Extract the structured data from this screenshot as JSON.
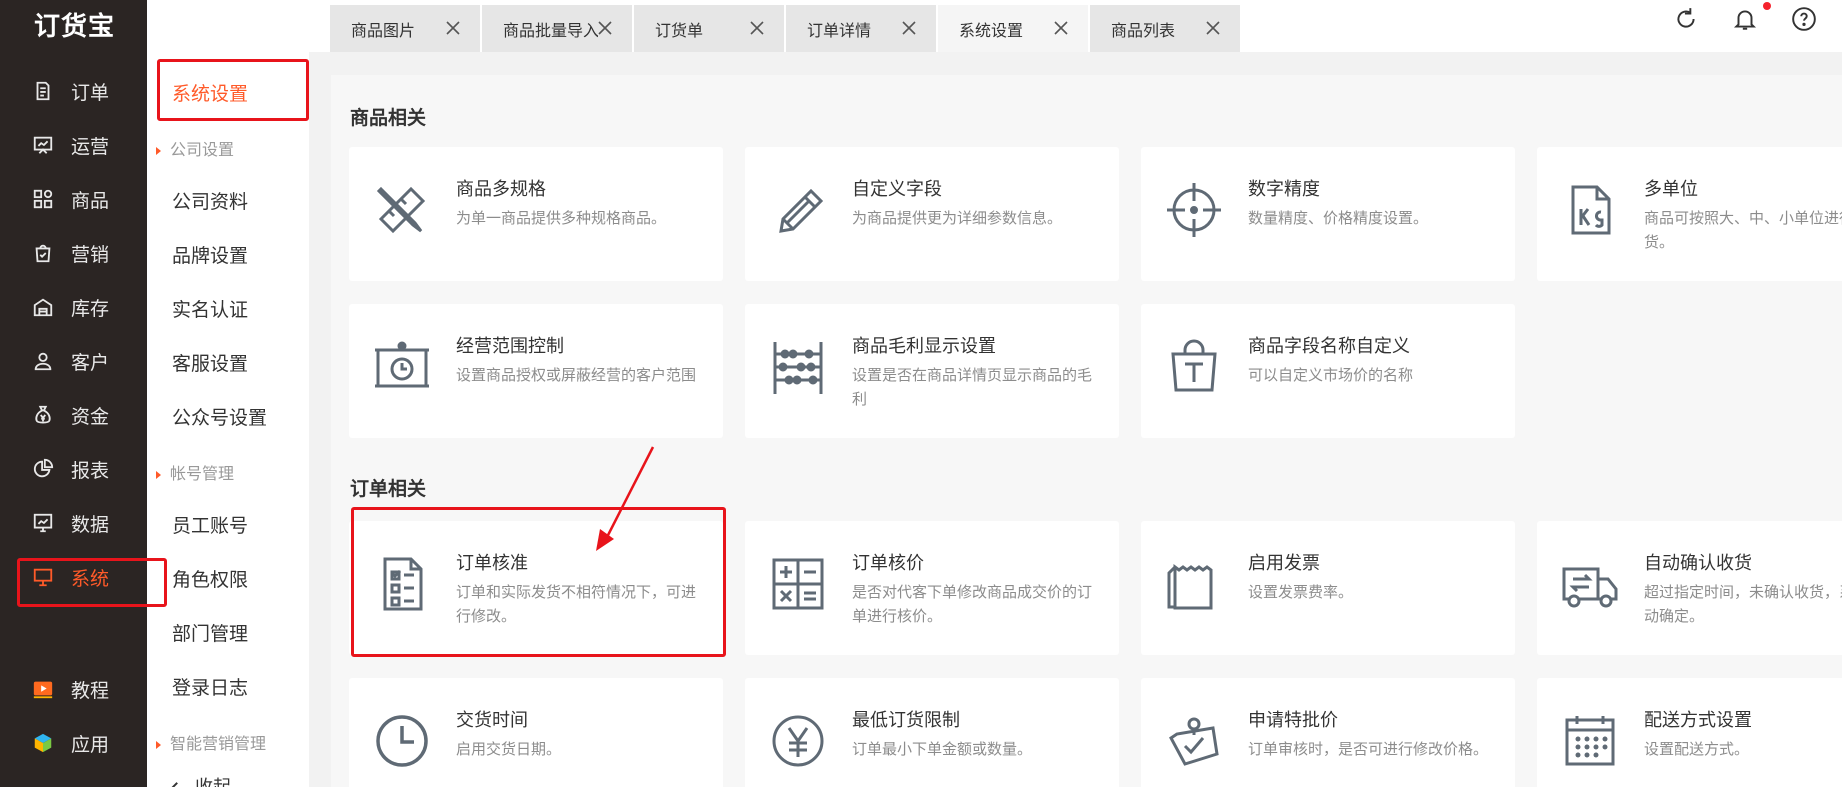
{
  "app": {
    "logo": "订货宝"
  },
  "nav": {
    "items": [
      {
        "label": "订单",
        "icon": "order-doc-icon"
      },
      {
        "label": "运营",
        "icon": "board-chart-icon"
      },
      {
        "label": "商品",
        "icon": "grid-apps-icon"
      },
      {
        "label": "营销",
        "icon": "marketing-bag-icon"
      },
      {
        "label": "库存",
        "icon": "warehouse-icon"
      },
      {
        "label": "客户",
        "icon": "user-icon"
      },
      {
        "label": "资金",
        "icon": "money-bag-icon"
      },
      {
        "label": "报表",
        "icon": "pie-chart-icon"
      },
      {
        "label": "数据",
        "icon": "data-chart-icon"
      },
      {
        "label": "系统",
        "icon": "monitor-icon"
      },
      {
        "label": "教程",
        "icon": "video-play-icon"
      },
      {
        "label": "应用",
        "icon": "cube-icon"
      }
    ]
  },
  "subnav": {
    "title": "系统设置",
    "group_company": "公司设置",
    "company_items": [
      "公司资料",
      "品牌设置",
      "实名认证",
      "客服设置",
      "公众号设置"
    ],
    "group_account": "帐号管理",
    "account_items": [
      "员工账号",
      "角色权限",
      "部门管理",
      "登录日志"
    ],
    "group_marketing": "智能营销管理",
    "collapse_label": "收起"
  },
  "tabs": [
    {
      "label": "商品图片"
    },
    {
      "label": "商品批量导入"
    },
    {
      "label": "订货单"
    },
    {
      "label": "订单详情"
    },
    {
      "label": "系统设置"
    },
    {
      "label": "商品列表"
    }
  ],
  "header_icons": [
    "refresh-icon",
    "bell-icon",
    "help-icon"
  ],
  "sections": {
    "goods": {
      "title": "商品相关",
      "cards": [
        {
          "title": "商品多规格",
          "desc": "为单一商品提供多种规格商品。",
          "icon": "ruler-pencil-icon"
        },
        {
          "title": "自定义字段",
          "desc": "为商品提供更为详细参数信息。",
          "icon": "pencil-icon"
        },
        {
          "title": "数字精度",
          "desc": "数量精度、价格精度设置。",
          "icon": "crosshair-icon"
        },
        {
          "title": "多单位",
          "desc": "商品可按照大、中、小单位进行订货。",
          "icon": "kg-file-icon"
        },
        {
          "title": "经营范围控制",
          "desc": "设置商品授权或屏蔽经营的客户范围",
          "icon": "presentation-clock-icon"
        },
        {
          "title": "商品毛利显示设置",
          "desc": "设置是否在商品详情页显示商品的毛利",
          "icon": "abacus-icon"
        },
        {
          "title": "商品字段名称自定义",
          "desc": "可以自定义市场价的名称",
          "icon": "t-bag-icon"
        }
      ]
    },
    "orders": {
      "title": "订单相关",
      "cards": [
        {
          "title": "订单核准",
          "desc": "订单和实际发货不相符情况下，可进行修改。",
          "icon": "checklist-doc-icon"
        },
        {
          "title": "订单核价",
          "desc": "是否对代客下单修改商品成交价的订单进行核价。",
          "icon": "calculator-icon"
        },
        {
          "title": "启用发票",
          "desc": "设置发票费率。",
          "icon": "invoice-icon"
        },
        {
          "title": "自动确认收货",
          "desc": "超过指定时间，未确认收货，系统自动确定。",
          "icon": "delivery-truck-icon"
        },
        {
          "title": "交货时间",
          "desc": "启用交货日期。",
          "icon": "clock-icon"
        },
        {
          "title": "最低订货限制",
          "desc": "订单最小下单金额或数量。",
          "icon": "yen-coin-icon"
        },
        {
          "title": "申请特批价",
          "desc": "订单审核时，是否可进行修改价格。",
          "icon": "clipboard-check-icon"
        },
        {
          "title": "配送方式设置",
          "desc": "设置配送方式。",
          "icon": "calendar-grid-icon"
        }
      ]
    }
  },
  "colors": {
    "accent": "#ff5a29",
    "nav_bg": "#2b2523",
    "annotation": "#e8141b",
    "icon_gray": "#5f6a75"
  }
}
